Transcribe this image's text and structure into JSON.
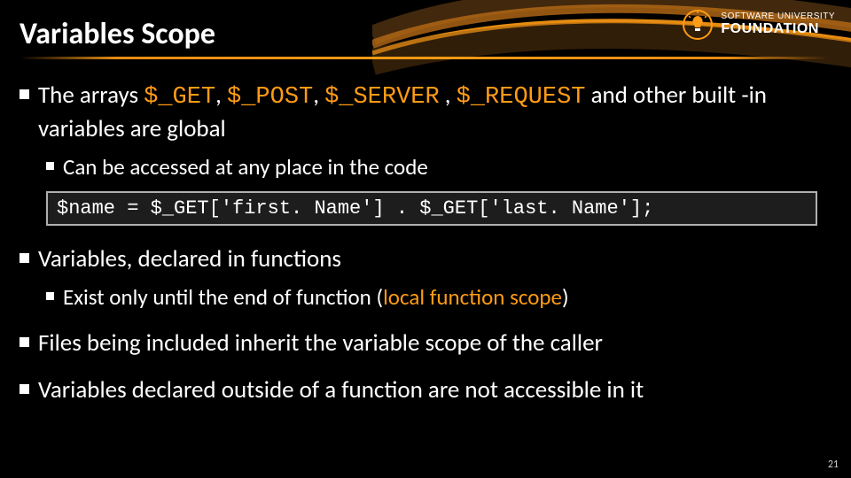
{
  "title": "Variables Scope",
  "logo": {
    "line1": "SOFTWARE UNIVERSITY",
    "line2": "FOUNDATION"
  },
  "bullets": {
    "b1": {
      "pre": "The arrays ",
      "v1": "$_GET",
      "s1": ", ",
      "v2": "$_POST",
      "s2": ", ",
      "v3": "$_SERVER",
      "s3": " , ",
      "v4": "$_REQUEST",
      "post": " and other built -in variables are global"
    },
    "b1_sub": "Can be accessed at any place in the code",
    "code": "$name = $_GET['first. Name'] . $_GET['last. Name'];",
    "b2": "Variables, declared in functions",
    "b2_sub_pre": "Exist only until the end of function (",
    "b2_sub_hl": "local function scope",
    "b2_sub_post": ")",
    "b3": "Files being included inherit the variable scope of the caller",
    "b4": "Variables declared outside of a function are not accessible in it"
  },
  "page_number": "21"
}
